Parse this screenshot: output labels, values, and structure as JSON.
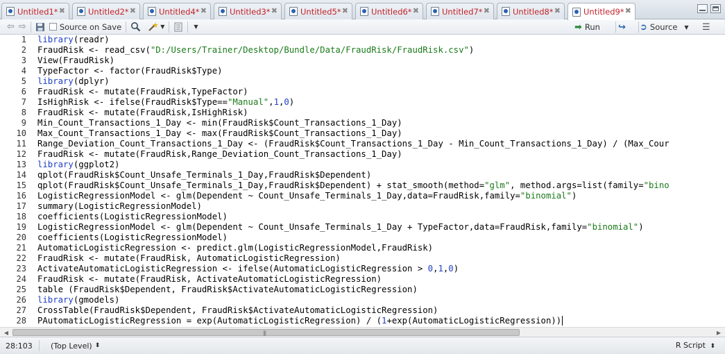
{
  "tabs": [
    {
      "label": "Untitled1*"
    },
    {
      "label": "Untitled2*"
    },
    {
      "label": "Untitled4*"
    },
    {
      "label": "Untitled3*"
    },
    {
      "label": "Untitled5*"
    },
    {
      "label": "Untitled6*"
    },
    {
      "label": "Untitled7*"
    },
    {
      "label": "Untitled8*"
    },
    {
      "label": "Untitled9*"
    }
  ],
  "active_tab": 8,
  "toolbar": {
    "source_on_save": "Source on Save",
    "run": "Run",
    "source": "Source"
  },
  "editor": {
    "lines": [
      "library(readr)",
      "FraudRisk <- read_csv(\"D:/Users/Trainer/Desktop/Bundle/Data/FraudRisk/FraudRisk.csv\")",
      "View(FraudRisk)",
      "TypeFactor <- factor(FraudRisk$Type)",
      "library(dplyr)",
      "FraudRisk <- mutate(FraudRisk,TypeFactor)",
      "IsHighRisk <- ifelse(FraudRisk$Type==\"Manual\",1,0)",
      "FraudRisk <- mutate(FraudRisk,IsHighRisk)",
      "Min_Count_Transactions_1_Day <- min(FraudRisk$Count_Transactions_1_Day)",
      "Max_Count_Transactions_1_Day <- max(FraudRisk$Count_Transactions_1_Day)",
      "Range_Deviation_Count_Transactions_1_Day <- (FraudRisk$Count_Transactions_1_Day - Min_Count_Transactions_1_Day) / (Max_Cour",
      "FraudRisk <- mutate(FraudRisk,Range_Deviation_Count_Transactions_1_Day)",
      "library(ggplot2)",
      "qplot(FraudRisk$Count_Unsafe_Terminals_1_Day,FraudRisk$Dependent)",
      "qplot(FraudRisk$Count_Unsafe_Terminals_1_Day,FraudRisk$Dependent) + stat_smooth(method=\"glm\", method.args=list(family=\"bino",
      "LogisticRegressionModel <- glm(Dependent ~ Count_Unsafe_Terminals_1_Day,data=FraudRisk,family=\"binomial\")",
      "summary(LogisticRegressionModel)",
      "coefficients(LogisticRegressionModel)",
      "LogisticRegressionModel <- glm(Dependent ~ Count_Unsafe_Terminals_1_Day + TypeFactor,data=FraudRisk,family=\"binomial\")",
      "coefficients(LogisticRegressionModel)",
      "AutomaticLogisticRegression <- predict.glm(LogisticRegressionModel,FraudRisk)",
      "FraudRisk <- mutate(FraudRisk, AutomaticLogisticRegression)",
      "ActivateAutomaticLogisticRegression <- ifelse(AutomaticLogisticRegression > 0,1,0)",
      "FraudRisk <- mutate(FraudRisk, ActivateAutomaticLogisticRegression)",
      "table (FraudRisk$Dependent, FraudRisk$ActivateAutomaticLogisticRegression)",
      "library(gmodels)",
      "CrossTable(FraudRisk$Dependent, FraudRisk$ActivateAutomaticLogisticRegression)",
      "PAutomaticLogisticRegression = exp(AutomaticLogisticRegression) / (1+exp(AutomaticLogisticRegression))"
    ]
  },
  "status": {
    "cursor_position": "28:103",
    "scope": "(Top Level)",
    "file_type": "R Script"
  },
  "colors": {
    "tab_label": "#c3232a",
    "keyword": "#1e3fc4",
    "string": "#1a7a1a"
  }
}
